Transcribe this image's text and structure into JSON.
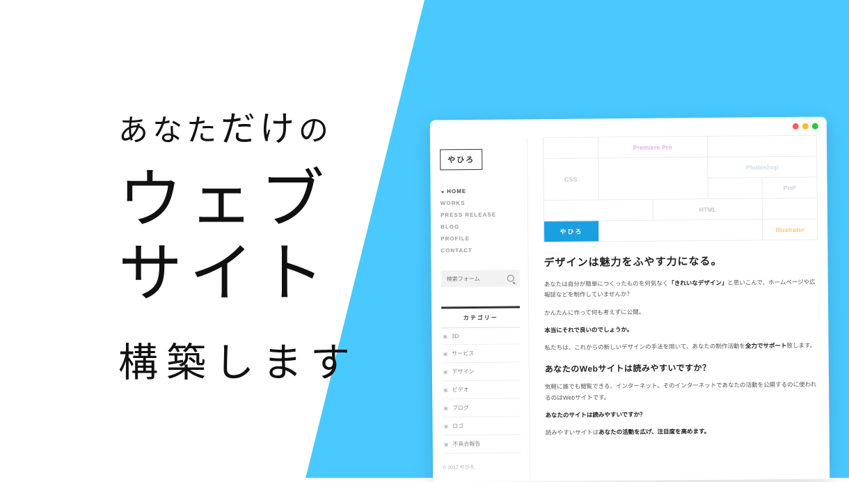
{
  "slogan": {
    "line1_pre": "あなた",
    "line1_hl": "だけ",
    "line1_post": "の",
    "line2": "ウェブ",
    "line3": "サイト",
    "line4": "構築します"
  },
  "logo": "やひろ",
  "nav": [
    "HOME",
    "WORKS",
    "PRESS RELEASE",
    "BLOG",
    "PROFILE",
    "CONTACT"
  ],
  "search": {
    "placeholder": "検索フォーム"
  },
  "category_title": "カテゴリー",
  "categories": [
    "3D",
    "サービス",
    "デザイン",
    "ビデオ",
    "ブログ",
    "ロゴ",
    "不具合報告"
  ],
  "copyright": "© 2017 やひろ.",
  "grid": {
    "premiere": "Premiere Pro",
    "css": "CSS",
    "photoshop": "Photoshop",
    "php": "PHP",
    "html": "HTML",
    "illustrator": "Illustrator",
    "brand": "やひろ"
  },
  "article": {
    "h1": "デザインは魅力をふやす力になる。",
    "p1_a": "あなたは自分が簡単につくったものを何気なく",
    "p1_b": "「きれいなデザイン」",
    "p1_c": "と思いこんで、ホームページや広報誌などを制作していませんか？",
    "p2": "かんたんに作って何も考えずに公開。",
    "p3": "本当にそれで良いのでしょうか。",
    "p4_a": "私たちは、これからの新しいデザインの手法を用いて、あなたの制作活動を",
    "p4_b": "全力でサポート",
    "p4_c": "致します。",
    "h2": "あなたのWebサイトは読みやすいですか？",
    "p5": "気軽に誰でも閲覧できる、インターネット。そのインターネットであなたの活動を公開するのに使われるのはWebサイトです。",
    "p6": "あなたのサイトは読みやすいですか？",
    "p7_a": "読みやすいサイトは",
    "p7_b": "あなたの活動を広げ、注目度を高めます。"
  }
}
